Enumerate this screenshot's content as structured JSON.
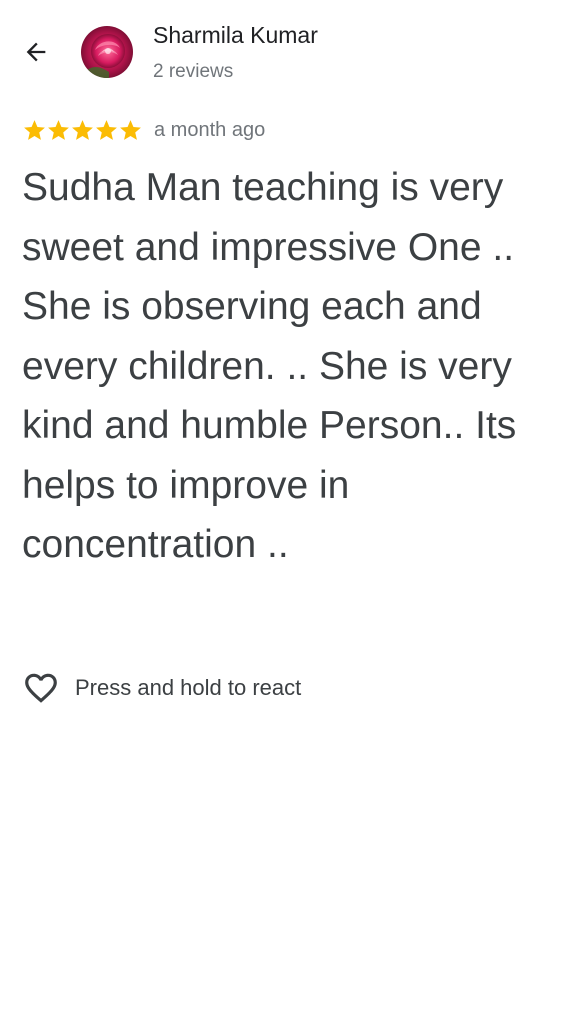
{
  "header": {
    "back_icon": "arrow-back-icon",
    "avatar_icon": "rose-avatar-image",
    "user_name": "Sharmila Kumar",
    "review_count": "2 reviews"
  },
  "review": {
    "rating": 5,
    "rating_max": 5,
    "star_color": "#fbbc04",
    "time_ago": "a month ago",
    "text": "Sudha Man teaching is very sweet and impressive One .. She is observing each and every children. .. She is very kind and humble Person.. Its helps to improve in concentration .."
  },
  "reaction": {
    "icon": "heart-outline-icon",
    "label": "Press and hold to react"
  }
}
